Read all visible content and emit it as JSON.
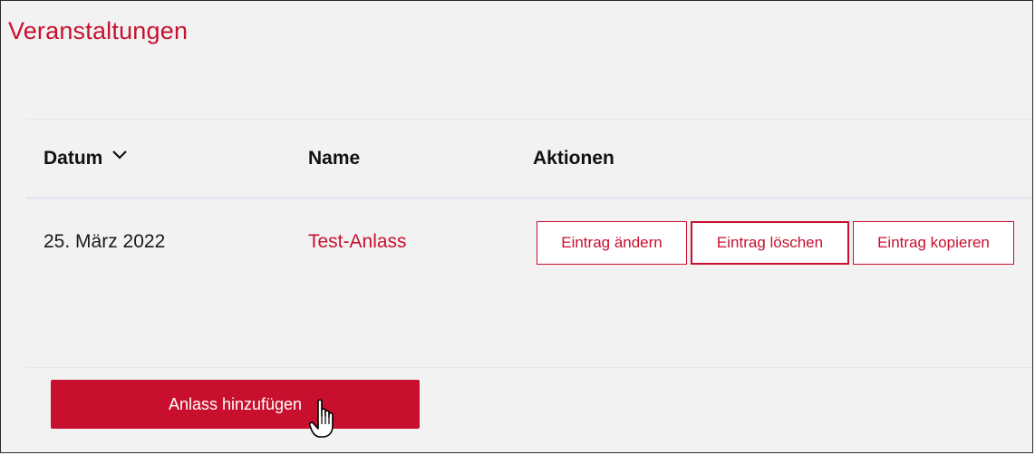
{
  "header": {
    "title": "Veranstaltungen"
  },
  "table": {
    "columns": {
      "datum": "Datum",
      "name": "Name",
      "aktionen": "Aktionen"
    },
    "sort_icon": "chevron-down-icon",
    "rows": [
      {
        "datum": "25. März 2022",
        "name": "Test-Anlass",
        "actions": {
          "edit": "Eintrag ändern",
          "delete": "Eintrag löschen",
          "copy": "Eintrag kopieren"
        }
      }
    ]
  },
  "footer": {
    "add_button": "Anlass hinzufügen",
    "cursor_icon": "hand-pointer-icon"
  },
  "colors": {
    "accent": "#c8102e",
    "background": "#f2f2f2",
    "text": "#111111"
  }
}
